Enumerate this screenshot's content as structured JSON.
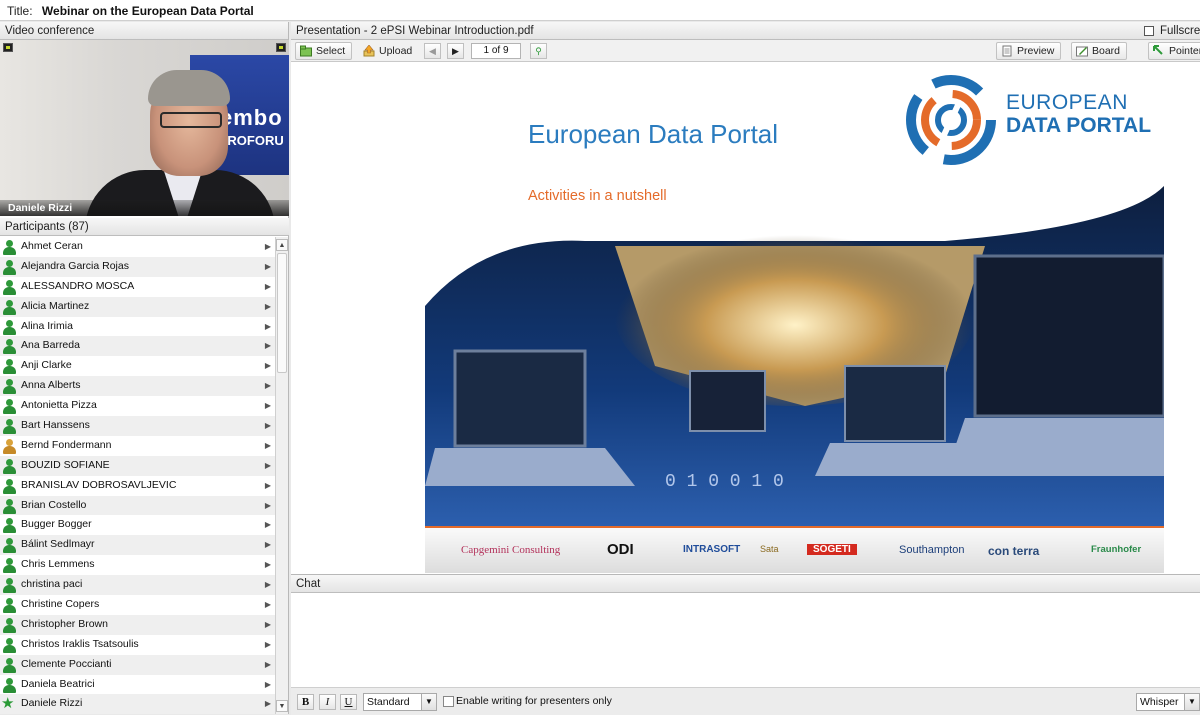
{
  "window": {
    "title_label": "Title:",
    "title": "Webinar on the European Data Portal"
  },
  "video": {
    "header": "Video conference",
    "speaker_name": "Daniele Rizzi",
    "banner_line1": "embo",
    "banner_line2": "UROFORU"
  },
  "participants": {
    "header": "Participants (87)",
    "items": [
      {
        "name": "Ahmet Ceran",
        "role": "attendee"
      },
      {
        "name": "Alejandra Garcia Rojas",
        "role": "attendee"
      },
      {
        "name": "ALESSANDRO MOSCA",
        "role": "attendee"
      },
      {
        "name": "Alicia Martinez",
        "role": "attendee"
      },
      {
        "name": "Alina Irimia",
        "role": "attendee"
      },
      {
        "name": "Ana Barreda",
        "role": "attendee"
      },
      {
        "name": "Anji Clarke",
        "role": "attendee"
      },
      {
        "name": "Anna Alberts",
        "role": "attendee"
      },
      {
        "name": "Antonietta Pizza",
        "role": "attendee"
      },
      {
        "name": "Bart Hanssens",
        "role": "attendee"
      },
      {
        "name": "Bernd Fondermann",
        "role": "presenter"
      },
      {
        "name": "BOUZID SOFIANE",
        "role": "attendee"
      },
      {
        "name": "BRANISLAV DOBROSAVLJEVIC",
        "role": "attendee"
      },
      {
        "name": "Brian  Costello",
        "role": "attendee"
      },
      {
        "name": "Bugger Bogger",
        "role": "attendee"
      },
      {
        "name": "Bálint Sedlmayr",
        "role": "attendee"
      },
      {
        "name": "Chris  Lemmens",
        "role": "attendee"
      },
      {
        "name": "christina paci",
        "role": "attendee"
      },
      {
        "name": "Christine Copers",
        "role": "attendee"
      },
      {
        "name": "Christopher Brown",
        "role": "attendee"
      },
      {
        "name": "Christos Iraklis Tsatsoulis",
        "role": "attendee"
      },
      {
        "name": "Clemente Poccianti",
        "role": "attendee"
      },
      {
        "name": "Daniela Beatrici",
        "role": "attendee"
      },
      {
        "name": "Daniele Rizzi",
        "role": "host"
      }
    ]
  },
  "presentation": {
    "header": "Presentation - 2 ePSI Webinar Introduction.pdf",
    "fullscreen_label": "Fullscreen",
    "toolbar": {
      "select": "Select",
      "upload": "Upload",
      "page": "1 of 9",
      "preview": "Preview",
      "board": "Board",
      "pointer": "Pointer"
    },
    "slide": {
      "title": "European Data Portal",
      "subtitle": "Activities in a nutshell",
      "logo_line1": "EUROPEAN",
      "logo_line2": "DATA PORTAL",
      "sponsors": [
        "Capgemini Consulting",
        "ODI",
        "INTRASOFT",
        "Sata",
        "SOGETI",
        "Southampton",
        "con terra",
        "Fraunhofer"
      ]
    }
  },
  "chat": {
    "header": "Chat",
    "bold": "B",
    "italic": "I",
    "underline": "U",
    "style_select": "Standard",
    "presenters_only_label": "Enable writing for presenters only",
    "whisper_select": "Whisper"
  },
  "colors": {
    "accent_blue": "#2b7cbf",
    "accent_orange": "#e46b2a",
    "user_green": "#2e9a3a"
  }
}
